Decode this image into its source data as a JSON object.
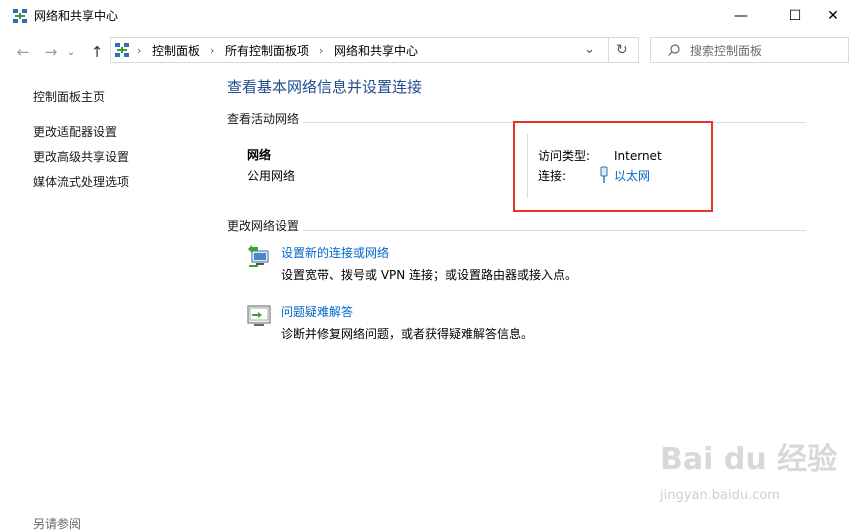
{
  "window": {
    "title": "网络和共享中心",
    "controls": {
      "minimize": "—",
      "maximize": "☐",
      "close": "✕"
    }
  },
  "nav": {
    "back": "←",
    "forward": "→",
    "up": "↑",
    "dropdown": "⌄",
    "refresh": "↻"
  },
  "breadcrumb": [
    "控制面板",
    "所有控制面板项",
    "网络和共享中心"
  ],
  "search": {
    "placeholder": "搜索控制面板"
  },
  "sidebar": {
    "home": "控制面板主页",
    "links": [
      "更改适配器设置",
      "更改高级共享设置",
      "媒体流式处理选项"
    ],
    "see_also": "另请参阅"
  },
  "main": {
    "title": "查看基本网络信息并设置连接",
    "active_section": "查看活动网络",
    "network": {
      "name": "网络",
      "type": "公用网络"
    },
    "access_type_label": "访问类型:",
    "access_type_value": "Internet",
    "connection_label": "连接:",
    "connection_value": "以太网",
    "change_section": "更改网络设置",
    "tasks": [
      {
        "title": "设置新的连接或网络",
        "desc": "设置宽带、拨号或 VPN 连接；或设置路由器或接入点。"
      },
      {
        "title": "问题疑难解答",
        "desc": "诊断并修复网络问题，或者获得疑难解答信息。"
      }
    ]
  },
  "watermark": {
    "logo": "Bai du 经验",
    "url": "jingyan.baidu.com"
  },
  "colors": {
    "accent": "#0066cc",
    "title_blue": "#1e4e8c",
    "highlight_red": "#e5332a"
  }
}
